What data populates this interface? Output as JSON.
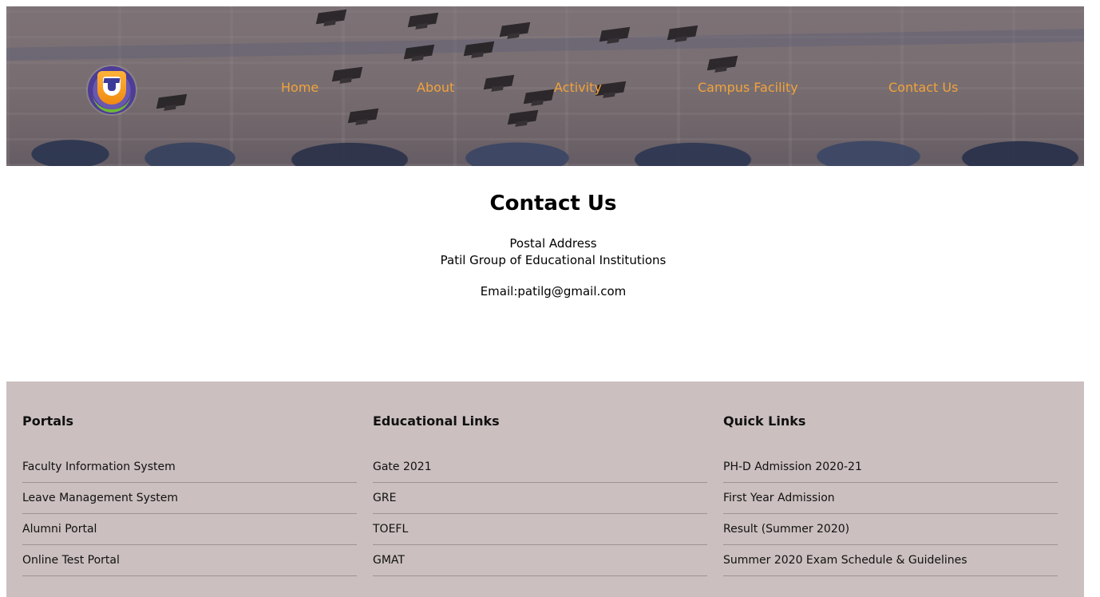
{
  "colors": {
    "nav_link": "#f2a23a",
    "footer_bg": "#cbbfbf",
    "divider": "#9e9494",
    "text": "#111111"
  },
  "header": {
    "nav": [
      {
        "label": "Home"
      },
      {
        "label": "About"
      },
      {
        "label": "Activity"
      },
      {
        "label": "Campus Facility"
      },
      {
        "label": "Contact Us"
      }
    ]
  },
  "main": {
    "title": "Contact Us",
    "postal_heading": "Postal Address",
    "institution": "Patil Group of Educational Institutions",
    "email": "Email:patilg@gmail.com"
  },
  "footer": {
    "columns": [
      {
        "heading": "Portals",
        "links": [
          "Faculty Information System",
          "Leave Management System",
          "Alumni Portal",
          "Online Test Portal"
        ]
      },
      {
        "heading": "Educational Links",
        "links": [
          "Gate 2021",
          "GRE",
          "TOEFL",
          "GMAT"
        ]
      },
      {
        "heading": "Quick Links",
        "links": [
          "PH-D Admission 2020-21",
          "First Year Admission",
          "Result (Summer 2020)",
          "Summer 2020 Exam Schedule & Guidelines"
        ]
      }
    ]
  }
}
